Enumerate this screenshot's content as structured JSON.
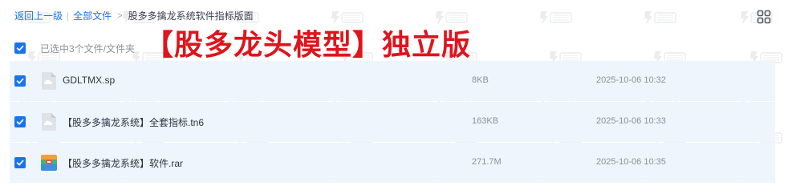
{
  "breadcrumb": {
    "back": "返回上一级",
    "all_files": "全部文件",
    "arrow": ">",
    "current": "股多多擒龙系统软件指标版面"
  },
  "selection": {
    "text": "已选中3个文件/文件夹"
  },
  "overlay": {
    "title": "【股多龙头模型】独立版"
  },
  "files": [
    {
      "name": "GDLTMX.sp",
      "size": "8KB",
      "modified": "2025-10-06 10:32",
      "icon": "cloud-file-icon"
    },
    {
      "name": "【股多多擒龙系统】全套指标.tn6",
      "size": "163KB",
      "modified": "2025-10-06 10:33",
      "icon": "cloud-file-icon"
    },
    {
      "name": "【股多多擒龙系统】软件.rar",
      "size": "271.7M",
      "modified": "2025-10-06 10:35",
      "icon": "archive-file-icon"
    }
  ],
  "colors": {
    "accent": "#1a73e8",
    "row_bg": "#eef5fd",
    "overlay_red": "#e0141c"
  }
}
